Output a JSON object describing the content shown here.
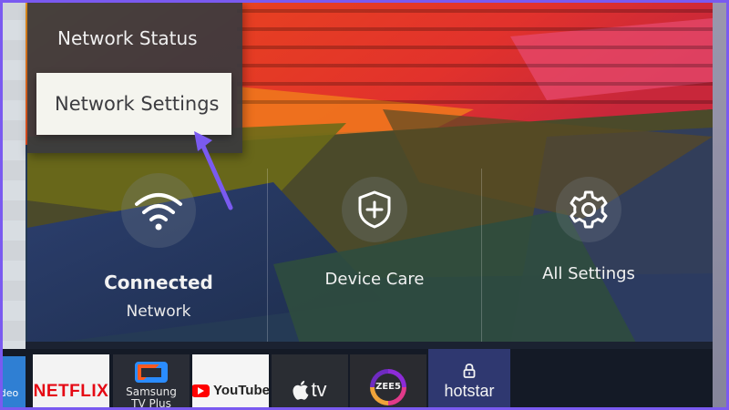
{
  "menu": {
    "items": [
      {
        "label": "Network Status",
        "selected": false
      },
      {
        "label": "Network Settings",
        "selected": true
      }
    ]
  },
  "tiles": [
    {
      "label": "Connected",
      "sublabel": "Network",
      "icon": "wifi-icon"
    },
    {
      "label": "Device Care",
      "icon": "shield-plus-icon"
    },
    {
      "label": "All Settings",
      "icon": "gear-icon"
    }
  ],
  "apps": [
    {
      "label": "deo",
      "icon": "samsung-video-icon"
    },
    {
      "label": "NETFLIX",
      "icon": "netflix-logo"
    },
    {
      "label": "Samsung TV Plus",
      "display": "Samsung\nTV Plus",
      "icon": "samsung-tv-plus-icon"
    },
    {
      "label": "YouTube",
      "icon": "youtube-play-icon"
    },
    {
      "label": "tv",
      "icon": "apple-icon"
    },
    {
      "label": "ZEE5",
      "icon": "zee5-ring-icon"
    },
    {
      "label": "hotstar",
      "icon": "lock-icon"
    }
  ],
  "colors": {
    "menu_panel": "#3a3a3e",
    "menu_selected": "#f4f4ee",
    "annotation_arrow": "#7a5af0",
    "frame": "#7a5af0",
    "netflix_red": "#e50914",
    "hotstar_bg": "#2f3870"
  }
}
